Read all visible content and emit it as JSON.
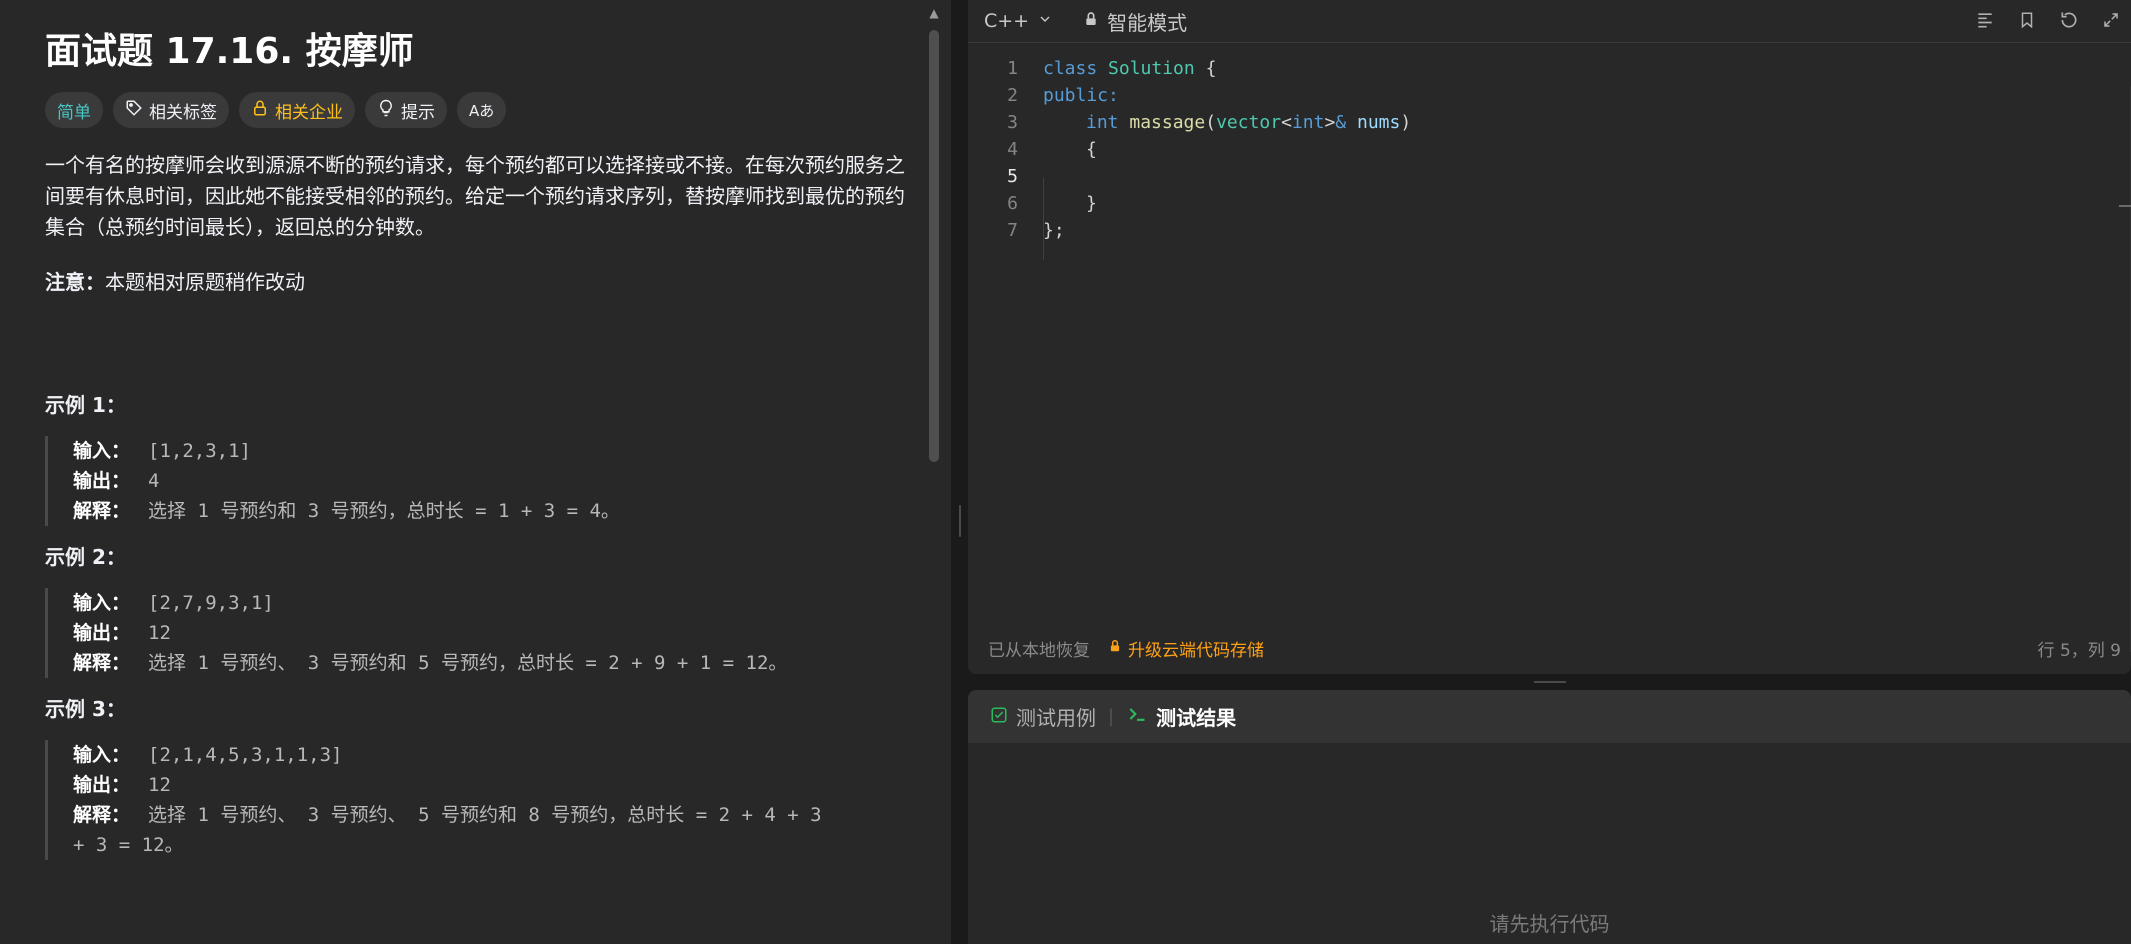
{
  "problem": {
    "title": "面试题 17.16. 按摩师",
    "tags": {
      "difficulty": "简单",
      "related_tags": "相关标签",
      "related_companies": "相关企业",
      "hint": "提示",
      "translate": "Aあ"
    },
    "description": "一个有名的按摩师会收到源源不断的预约请求，每个预约都可以选择接或不接。在每次预约服务之间要有休息时间，因此她不能接受相邻的预约。给定一个预约请求序列，替按摩师找到最优的预约集合（总预约时间最长），返回总的分钟数。",
    "note_label": "注意：",
    "note_text": "本题相对原题稍作改动",
    "examples": [
      {
        "title": "示例 1：",
        "input_label": "输入：",
        "input": "[1,2,3,1]",
        "output_label": "输出：",
        "output": "4",
        "explain_label": "解释：",
        "explain": "选择 1 号预约和 3 号预约，总时长 = 1 + 3 = 4。",
        "explain_cont": ""
      },
      {
        "title": "示例 2：",
        "input_label": "输入：",
        "input": "[2,7,9,3,1]",
        "output_label": "输出：",
        "output": "12",
        "explain_label": "解释：",
        "explain": "选择 1 号预约、 3 号预约和 5 号预约，总时长 = 2 + 9 + 1 = 12。",
        "explain_cont": ""
      },
      {
        "title": "示例 3：",
        "input_label": "输入：",
        "input": "[2,1,4,5,3,1,1,3]",
        "output_label": "输出：",
        "output": "12",
        "explain_label": "解释：",
        "explain": "选择 1 号预约、 3 号预约、 5 号预约和 8 号预约，总时长 = 2 + 4 + 3",
        "explain_cont": "+ 3 = 12。"
      }
    ]
  },
  "editor": {
    "language": "C++",
    "mode": "智能模式",
    "line_numbers": [
      "1",
      "2",
      "3",
      "4",
      "5",
      "6",
      "7"
    ],
    "code": {
      "l1_kw": "class",
      "l1_cls": "Solution",
      "l1_punc": " {",
      "l2": "public:",
      "l3_kw": "int",
      "l3_fn": "massage",
      "l3_open": "(",
      "l3_type": "vector",
      "l3_lt": "<",
      "l3_int": "int",
      "l3_gt": ">",
      "l3_amp": "&",
      "l3_var": "nums",
      "l3_close": ")",
      "l4": "{",
      "l5": "",
      "l6": "}",
      "l7": "};"
    },
    "status": {
      "restore": "已从本地恢复",
      "upgrade": "升级云端代码存储",
      "cursor": "行 5，列 9"
    }
  },
  "console": {
    "tab_testcase": "测试用例",
    "tab_separator": "|",
    "tab_result": "测试结果",
    "empty_message": "请先执行代码"
  },
  "colors": {
    "accent_orange": "#ffa116",
    "easy_teal": "#46c6c2",
    "company_gold": "#ffc01e",
    "success_green": "#2cbb5d"
  }
}
